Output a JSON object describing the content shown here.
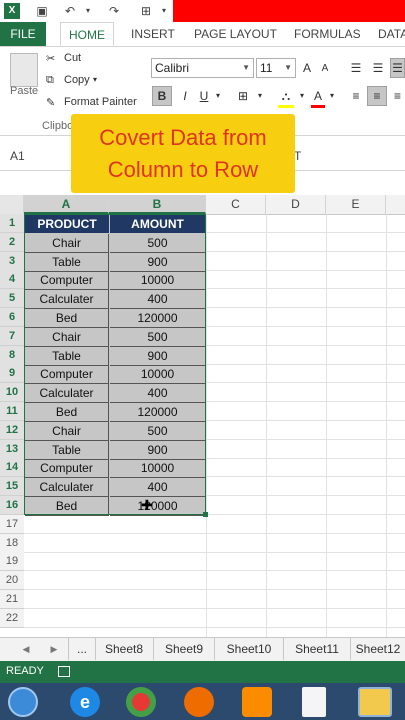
{
  "ribbon_tabs": {
    "file": "FILE",
    "home": "HOME",
    "insert": "INSERT",
    "page_layout": "PAGE LAYOUT",
    "formulas": "FORMULAS",
    "data": "DATA"
  },
  "clipboard": {
    "paste": "Paste",
    "cut": "Cut",
    "copy": "Copy",
    "format_painter": "Format Painter",
    "group_label": "Clipbo"
  },
  "font": {
    "name": "Calibri",
    "size": "11",
    "bold": "B",
    "italic": "I",
    "underline": "U",
    "grow": "A",
    "shrink": "A",
    "font_color": "A"
  },
  "formula_bar": {
    "name_box": "A1",
    "partial_text": "T"
  },
  "banner": {
    "line1": "Covert Data from",
    "line2": "Column to Row",
    "color": "#f7cf10",
    "text_color": "#e0341e"
  },
  "columns": [
    "A",
    "B",
    "C",
    "D",
    "E"
  ],
  "rows": [
    "1",
    "2",
    "3",
    "4",
    "5",
    "6",
    "7",
    "8",
    "9",
    "10",
    "11",
    "12",
    "13",
    "14",
    "15",
    "16",
    "17",
    "18",
    "19",
    "20",
    "21",
    "22"
  ],
  "table": {
    "headers": [
      "PRODUCT",
      "AMOUNT"
    ],
    "rows": [
      [
        "Chair",
        "500"
      ],
      [
        "Table",
        "900"
      ],
      [
        "Computer",
        "10000"
      ],
      [
        "Calculater",
        "400"
      ],
      [
        "Bed",
        "120000"
      ],
      [
        "Chair",
        "500"
      ],
      [
        "Table",
        "900"
      ],
      [
        "Computer",
        "10000"
      ],
      [
        "Calculater",
        "400"
      ],
      [
        "Bed",
        "120000"
      ],
      [
        "Chair",
        "500"
      ],
      [
        "Table",
        "900"
      ],
      [
        "Computer",
        "10000"
      ],
      [
        "Calculater",
        "400"
      ],
      [
        "Bed",
        "120000"
      ]
    ]
  },
  "sheet_tabs": {
    "ellipsis": "...",
    "tabs": [
      "Sheet8",
      "Sheet9",
      "Sheet10",
      "Sheet11",
      "Sheet12"
    ]
  },
  "status": {
    "mode": "READY"
  },
  "colors": {
    "excel_green": "#217346",
    "header_fill": "#1f3864",
    "selection": "#c6c6c6"
  }
}
